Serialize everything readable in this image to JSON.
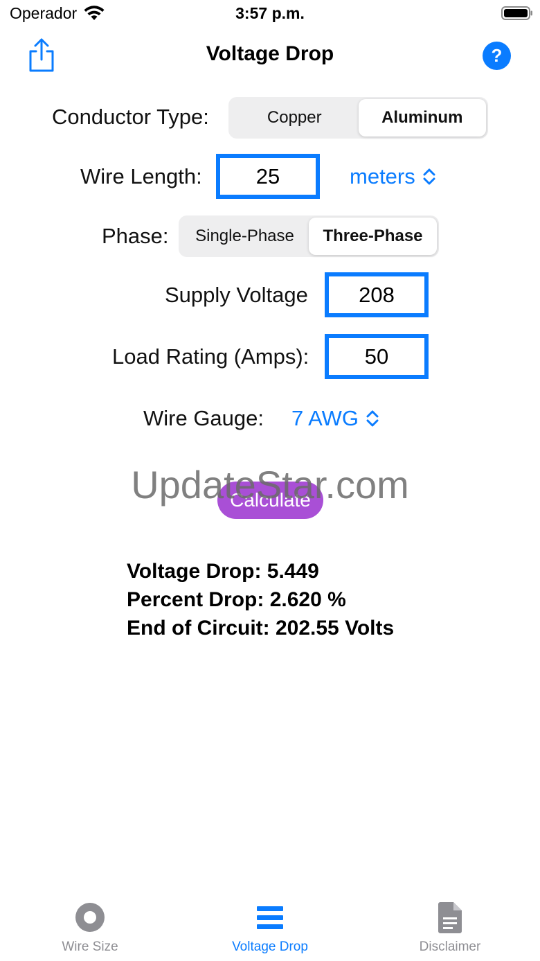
{
  "status_bar": {
    "carrier": "Operador",
    "time": "3:57 p.m."
  },
  "nav": {
    "title": "Voltage Drop",
    "help_label": "?"
  },
  "form": {
    "conductor": {
      "label": "Conductor Type:",
      "options": [
        "Copper",
        "Aluminum"
      ],
      "selected": "Aluminum"
    },
    "length": {
      "label": "Wire Length:",
      "value": "25",
      "units": "meters"
    },
    "phase": {
      "label": "Phase:",
      "options": [
        "Single-Phase",
        "Three-Phase"
      ],
      "selected": "Three-Phase"
    },
    "voltage": {
      "label": "Supply Voltage",
      "value": "208"
    },
    "load": {
      "label": "Load Rating (Amps):",
      "value": "50"
    },
    "gauge": {
      "label": "Wire Gauge:",
      "value": "7 AWG"
    }
  },
  "calculate_label": "Calculate",
  "watermark": "UpdateStar.com",
  "results": {
    "voltage_drop": "Voltage Drop: 5.449",
    "percent_drop": "Percent Drop: 2.620 %",
    "end_of_circuit": "End of Circuit: 202.55 Volts"
  },
  "tabs": [
    {
      "label": "Wire Size",
      "icon": "target-icon",
      "active": false
    },
    {
      "label": "Voltage Drop",
      "icon": "list-icon",
      "active": true
    },
    {
      "label": "Disclaimer",
      "icon": "document-icon",
      "active": false
    }
  ],
  "colors": {
    "accent": "#0a7cff",
    "calculate": "#a94fd6",
    "inactive_tab": "#8e8e93"
  }
}
